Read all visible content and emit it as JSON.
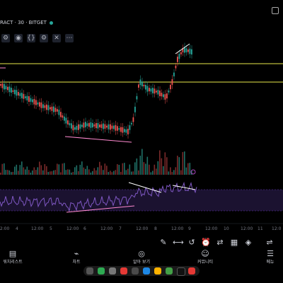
{
  "chart": {
    "title": "RACT · 30 · BITGET",
    "status_color": "#26a69a"
  },
  "indicators": {
    "row_icons": [
      "settings",
      "eye",
      "code",
      "settings",
      "close",
      "more"
    ]
  },
  "toolbar": {
    "icons": [
      "pencil-icon",
      "measure-icon",
      "replay-icon",
      "alarm-icon",
      "swap-icon",
      "calculator-icon",
      "layers-icon",
      "adjust-icon"
    ]
  },
  "time_axis": {
    "labels": [
      "12:00",
      "4",
      "12:00",
      "5",
      "12:00",
      "6",
      "12:00",
      "7",
      "12:00",
      "8",
      "12:00",
      "9",
      "12:00",
      "10",
      "12:00",
      "11",
      "12:0"
    ]
  },
  "bottom_nav": {
    "items": [
      {
        "label": "워치리스트",
        "icon": "list"
      },
      {
        "label": "차트",
        "icon": "chart"
      },
      {
        "label": "알아 보기",
        "icon": "compass"
      },
      {
        "label": "커뮤니티",
        "icon": "people"
      },
      {
        "label": "메뉴",
        "icon": "menu"
      }
    ]
  },
  "colors": {
    "background": "#000000",
    "up": "#26a69a",
    "down": "#ef5350",
    "level_line": "#e8e84a",
    "trend_line": "#ff8ad0",
    "oscillator": "#7e57c2"
  }
}
